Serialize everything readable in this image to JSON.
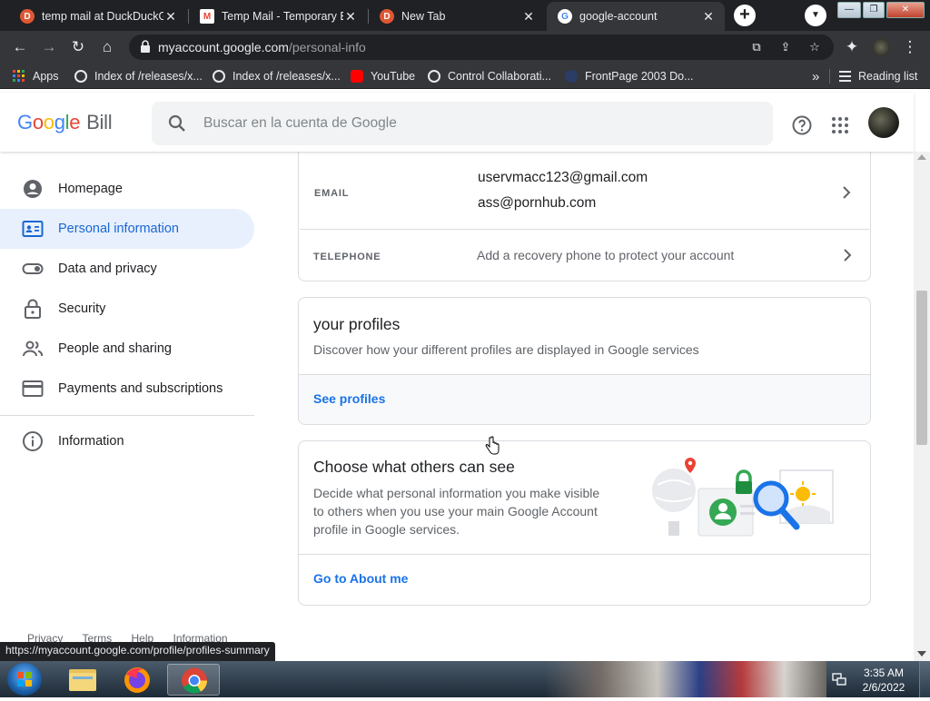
{
  "browser": {
    "tabs": [
      {
        "title": "temp mail at DuckDuckG",
        "icon": "duckduckgo-icon",
        "active": false
      },
      {
        "title": "Temp Mail - Temporary E",
        "icon": "gmail-icon",
        "active": false
      },
      {
        "title": "New Tab",
        "icon": "duckduckgo-icon",
        "active": false
      },
      {
        "title": "google-account",
        "icon": "google-icon",
        "active": true
      }
    ],
    "url_host": "myaccount.google.com",
    "url_path": "/personal-info",
    "bookmarks": [
      {
        "label": "Apps",
        "icon": "apps-grid-icon"
      },
      {
        "label": "Index of /releases/x...",
        "icon": "globe-icon"
      },
      {
        "label": "Index of /releases/x...",
        "icon": "globe-icon"
      },
      {
        "label": "YouTube",
        "icon": "youtube-icon"
      },
      {
        "label": "Control Collaborati...",
        "icon": "globe-icon"
      },
      {
        "label": "FrontPage 2003 Do...",
        "icon": "page-icon"
      }
    ],
    "overflow": "»",
    "reading_list": "Reading list",
    "status_url": "https://myaccount.google.com/profile/profiles-summary"
  },
  "header": {
    "logo": "Google",
    "product": "Bill",
    "search_placeholder": "Buscar en la cuenta de Google"
  },
  "sidebar": {
    "items": [
      {
        "label": "Homepage",
        "icon": "account-circle-icon",
        "active": false
      },
      {
        "label": "Personal information",
        "icon": "id-card-icon",
        "active": true
      },
      {
        "label": "Data and privacy",
        "icon": "toggle-icon",
        "active": false
      },
      {
        "label": "Security",
        "icon": "lock-icon",
        "active": false
      },
      {
        "label": "People and sharing",
        "icon": "people-icon",
        "active": false
      },
      {
        "label": "Payments and subscriptions",
        "icon": "credit-card-icon",
        "active": false
      }
    ],
    "info": {
      "label": "Information",
      "icon": "info-icon"
    },
    "footer": [
      "Privacy",
      "Terms",
      "Help",
      "Information"
    ]
  },
  "contact": {
    "email_label": "EMAIL",
    "emails": [
      "uservmacc123@gmail.com",
      "ass@pornhub.com"
    ],
    "phone_label": "TELEPHONE",
    "phone_value": "Add a recovery phone to protect your account"
  },
  "profiles_card": {
    "title": "your profiles",
    "description": "Discover how your different profiles are displayed in Google services",
    "link": "See profiles"
  },
  "visibility_card": {
    "title": "Choose what others can see",
    "description_lines": [
      "Decide what personal information you make visible",
      "to others when you use your main Google Account",
      "profile in Google services."
    ],
    "link": "Go to About me"
  },
  "taskbar": {
    "time": "3:35 AM",
    "date": "2/6/2022"
  },
  "colors": {
    "accent": "#1a73e8",
    "active_nav_bg": "#e8f0fe",
    "chrome_dark": "#202124"
  }
}
